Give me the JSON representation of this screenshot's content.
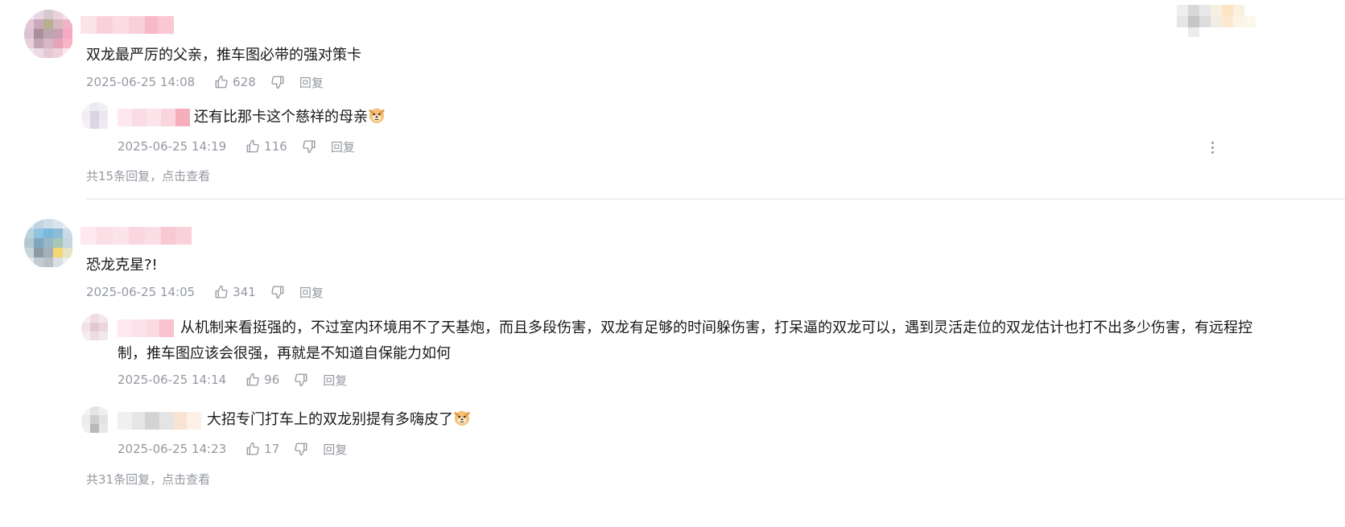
{
  "comments": [
    {
      "content": "双龙最严厉的父亲，推车图必带的强对策卡",
      "time": "2025-06-25 14:08",
      "likes": "628",
      "reply_label": "回复",
      "more_replies": "共15条回复，点击查看",
      "replies": [
        {
          "content": "还有比那卡这个慈祥的母亲",
          "time": "2025-06-25 14:19",
          "likes": "116",
          "reply_label": "回复"
        }
      ]
    },
    {
      "content": "恐龙克星?!",
      "time": "2025-06-25 14:05",
      "likes": "341",
      "reply_label": "回复",
      "more_replies": "共31条回复，点击查看",
      "replies": [
        {
          "content": "从机制来看挺强的，不过室内环境用不了天基炮，而且多段伤害，双龙有足够的时间躲伤害，打呆逼的双龙可以，遇到灵活走位的双龙估计也打不出多少伤害，有远程控制，推车图应该会很强，再就是不知道自保能力如何",
          "time": "2025-06-25 14:14",
          "likes": "96",
          "reply_label": "回复"
        },
        {
          "content": "大招专门打车上的双龙别提有多嗨皮了",
          "time": "2025-06-25 14:23",
          "likes": "17",
          "reply_label": "回复"
        }
      ]
    }
  ],
  "icons": {
    "like": "thumbs-up-icon",
    "dislike": "thumbs-down-icon",
    "more": "more-vertical-icon",
    "emoji": "doge-emoji"
  },
  "colors": {
    "text": "#18191c",
    "meta": "#9499a0",
    "divider": "#e3e5e7"
  }
}
